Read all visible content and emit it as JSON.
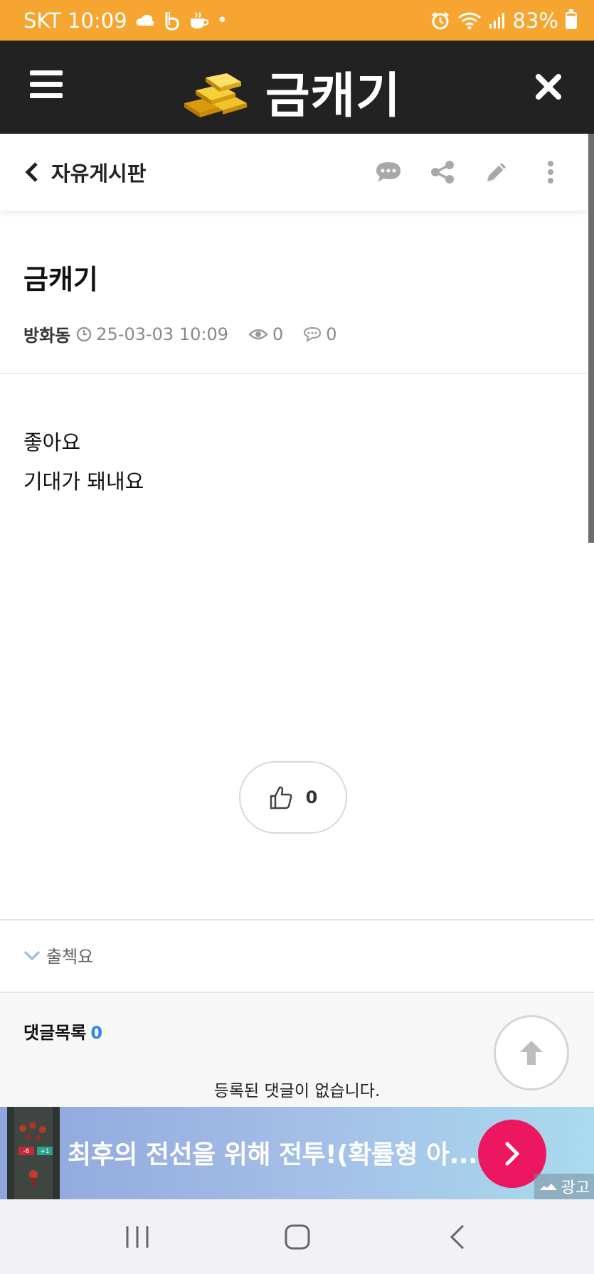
{
  "status_bar": {
    "carrier_time": "SKT 10:09",
    "battery": "83%"
  },
  "app": {
    "title": "금캐기"
  },
  "board": {
    "name": "자유게시판"
  },
  "post": {
    "title": "금캐기",
    "author": "방화동",
    "datetime": "25-03-03 10:09",
    "views": "0",
    "comments": "0",
    "content": [
      "좋아요",
      "기대가 돼내요"
    ],
    "likes": "0"
  },
  "tags": {
    "label": "출첵요"
  },
  "comment_section": {
    "title": "댓글목록",
    "count": "0",
    "empty_message": "등록된 댓글이 없습니다."
  },
  "ad": {
    "text": "최후의 전선을 위해 전투!(확률형 아...",
    "label": "광고",
    "thumb_badge_left": "-6",
    "thumb_badge_right": "+1"
  },
  "colors": {
    "status_bar": "#f7a531",
    "app_bar": "#222222",
    "comment_count": "#2f86e0",
    "ad_button": "#ed1661"
  }
}
